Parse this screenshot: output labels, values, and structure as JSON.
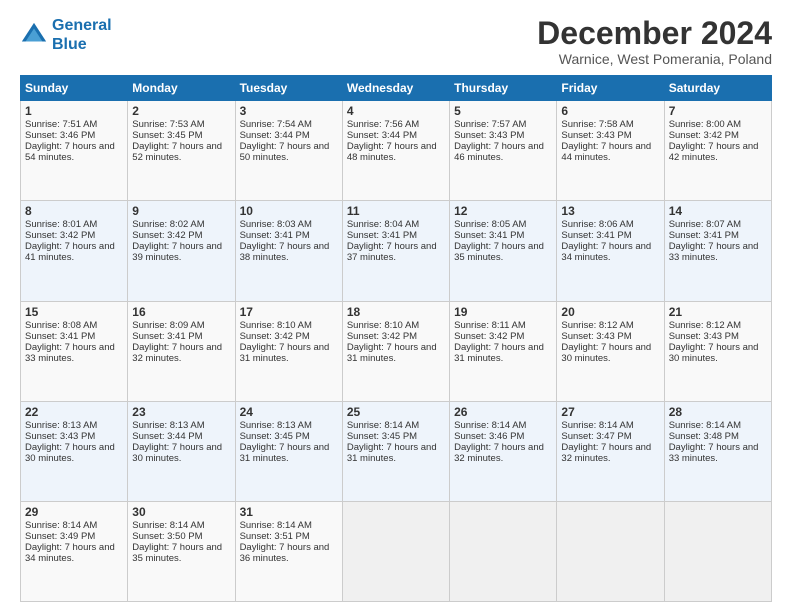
{
  "logo": {
    "line1": "General",
    "line2": "Blue"
  },
  "title": "December 2024",
  "subtitle": "Warnice, West Pomerania, Poland",
  "days_header": [
    "Sunday",
    "Monday",
    "Tuesday",
    "Wednesday",
    "Thursday",
    "Friday",
    "Saturday"
  ],
  "weeks": [
    [
      {
        "day": "1",
        "sunrise": "Sunrise: 7:51 AM",
        "sunset": "Sunset: 3:46 PM",
        "daylight": "Daylight: 7 hours and 54 minutes."
      },
      {
        "day": "2",
        "sunrise": "Sunrise: 7:53 AM",
        "sunset": "Sunset: 3:45 PM",
        "daylight": "Daylight: 7 hours and 52 minutes."
      },
      {
        "day": "3",
        "sunrise": "Sunrise: 7:54 AM",
        "sunset": "Sunset: 3:44 PM",
        "daylight": "Daylight: 7 hours and 50 minutes."
      },
      {
        "day": "4",
        "sunrise": "Sunrise: 7:56 AM",
        "sunset": "Sunset: 3:44 PM",
        "daylight": "Daylight: 7 hours and 48 minutes."
      },
      {
        "day": "5",
        "sunrise": "Sunrise: 7:57 AM",
        "sunset": "Sunset: 3:43 PM",
        "daylight": "Daylight: 7 hours and 46 minutes."
      },
      {
        "day": "6",
        "sunrise": "Sunrise: 7:58 AM",
        "sunset": "Sunset: 3:43 PM",
        "daylight": "Daylight: 7 hours and 44 minutes."
      },
      {
        "day": "7",
        "sunrise": "Sunrise: 8:00 AM",
        "sunset": "Sunset: 3:42 PM",
        "daylight": "Daylight: 7 hours and 42 minutes."
      }
    ],
    [
      {
        "day": "8",
        "sunrise": "Sunrise: 8:01 AM",
        "sunset": "Sunset: 3:42 PM",
        "daylight": "Daylight: 7 hours and 41 minutes."
      },
      {
        "day": "9",
        "sunrise": "Sunrise: 8:02 AM",
        "sunset": "Sunset: 3:42 PM",
        "daylight": "Daylight: 7 hours and 39 minutes."
      },
      {
        "day": "10",
        "sunrise": "Sunrise: 8:03 AM",
        "sunset": "Sunset: 3:41 PM",
        "daylight": "Daylight: 7 hours and 38 minutes."
      },
      {
        "day": "11",
        "sunrise": "Sunrise: 8:04 AM",
        "sunset": "Sunset: 3:41 PM",
        "daylight": "Daylight: 7 hours and 37 minutes."
      },
      {
        "day": "12",
        "sunrise": "Sunrise: 8:05 AM",
        "sunset": "Sunset: 3:41 PM",
        "daylight": "Daylight: 7 hours and 35 minutes."
      },
      {
        "day": "13",
        "sunrise": "Sunrise: 8:06 AM",
        "sunset": "Sunset: 3:41 PM",
        "daylight": "Daylight: 7 hours and 34 minutes."
      },
      {
        "day": "14",
        "sunrise": "Sunrise: 8:07 AM",
        "sunset": "Sunset: 3:41 PM",
        "daylight": "Daylight: 7 hours and 33 minutes."
      }
    ],
    [
      {
        "day": "15",
        "sunrise": "Sunrise: 8:08 AM",
        "sunset": "Sunset: 3:41 PM",
        "daylight": "Daylight: 7 hours and 33 minutes."
      },
      {
        "day": "16",
        "sunrise": "Sunrise: 8:09 AM",
        "sunset": "Sunset: 3:41 PM",
        "daylight": "Daylight: 7 hours and 32 minutes."
      },
      {
        "day": "17",
        "sunrise": "Sunrise: 8:10 AM",
        "sunset": "Sunset: 3:42 PM",
        "daylight": "Daylight: 7 hours and 31 minutes."
      },
      {
        "day": "18",
        "sunrise": "Sunrise: 8:10 AM",
        "sunset": "Sunset: 3:42 PM",
        "daylight": "Daylight: 7 hours and 31 minutes."
      },
      {
        "day": "19",
        "sunrise": "Sunrise: 8:11 AM",
        "sunset": "Sunset: 3:42 PM",
        "daylight": "Daylight: 7 hours and 31 minutes."
      },
      {
        "day": "20",
        "sunrise": "Sunrise: 8:12 AM",
        "sunset": "Sunset: 3:43 PM",
        "daylight": "Daylight: 7 hours and 30 minutes."
      },
      {
        "day": "21",
        "sunrise": "Sunrise: 8:12 AM",
        "sunset": "Sunset: 3:43 PM",
        "daylight": "Daylight: 7 hours and 30 minutes."
      }
    ],
    [
      {
        "day": "22",
        "sunrise": "Sunrise: 8:13 AM",
        "sunset": "Sunset: 3:43 PM",
        "daylight": "Daylight: 7 hours and 30 minutes."
      },
      {
        "day": "23",
        "sunrise": "Sunrise: 8:13 AM",
        "sunset": "Sunset: 3:44 PM",
        "daylight": "Daylight: 7 hours and 30 minutes."
      },
      {
        "day": "24",
        "sunrise": "Sunrise: 8:13 AM",
        "sunset": "Sunset: 3:45 PM",
        "daylight": "Daylight: 7 hours and 31 minutes."
      },
      {
        "day": "25",
        "sunrise": "Sunrise: 8:14 AM",
        "sunset": "Sunset: 3:45 PM",
        "daylight": "Daylight: 7 hours and 31 minutes."
      },
      {
        "day": "26",
        "sunrise": "Sunrise: 8:14 AM",
        "sunset": "Sunset: 3:46 PM",
        "daylight": "Daylight: 7 hours and 32 minutes."
      },
      {
        "day": "27",
        "sunrise": "Sunrise: 8:14 AM",
        "sunset": "Sunset: 3:47 PM",
        "daylight": "Daylight: 7 hours and 32 minutes."
      },
      {
        "day": "28",
        "sunrise": "Sunrise: 8:14 AM",
        "sunset": "Sunset: 3:48 PM",
        "daylight": "Daylight: 7 hours and 33 minutes."
      }
    ],
    [
      {
        "day": "29",
        "sunrise": "Sunrise: 8:14 AM",
        "sunset": "Sunset: 3:49 PM",
        "daylight": "Daylight: 7 hours and 34 minutes."
      },
      {
        "day": "30",
        "sunrise": "Sunrise: 8:14 AM",
        "sunset": "Sunset: 3:50 PM",
        "daylight": "Daylight: 7 hours and 35 minutes."
      },
      {
        "day": "31",
        "sunrise": "Sunrise: 8:14 AM",
        "sunset": "Sunset: 3:51 PM",
        "daylight": "Daylight: 7 hours and 36 minutes."
      },
      null,
      null,
      null,
      null
    ]
  ]
}
